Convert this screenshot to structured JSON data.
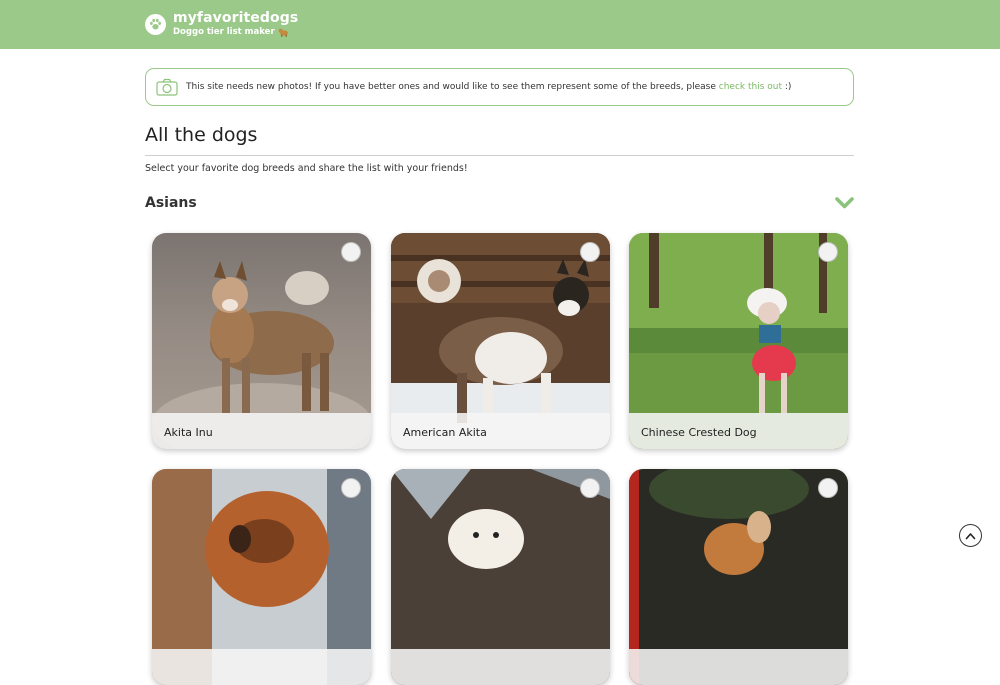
{
  "header": {
    "site_name": "myfavoritedogs",
    "tagline": "Doggo tier list maker",
    "logo_icon": "paw-icon",
    "tagline_icon": "dog-emoji-icon",
    "bar_color": "#9bc98a"
  },
  "notice": {
    "icon": "camera-icon",
    "text": "This site needs new photos! If you have better ones and would like to see them represent some of the breeds, please ",
    "link_text": "check this out",
    "suffix": " :)"
  },
  "page": {
    "title": "All the dogs",
    "subtitle": "Select your favorite dog breeds and share the list with your friends!"
  },
  "group": {
    "title": "Asians",
    "toggle_icon": "chevron-down-icon",
    "accent_color": "#8cc37a"
  },
  "cards": [
    {
      "label": "Akita Inu",
      "selected": false
    },
    {
      "label": "American Akita",
      "selected": false
    },
    {
      "label": "Chinese Crested Dog",
      "selected": false
    },
    {
      "label": "",
      "selected": false
    },
    {
      "label": "",
      "selected": false
    },
    {
      "label": "",
      "selected": false
    }
  ],
  "scroll_top_icon": "chevron-up-icon"
}
